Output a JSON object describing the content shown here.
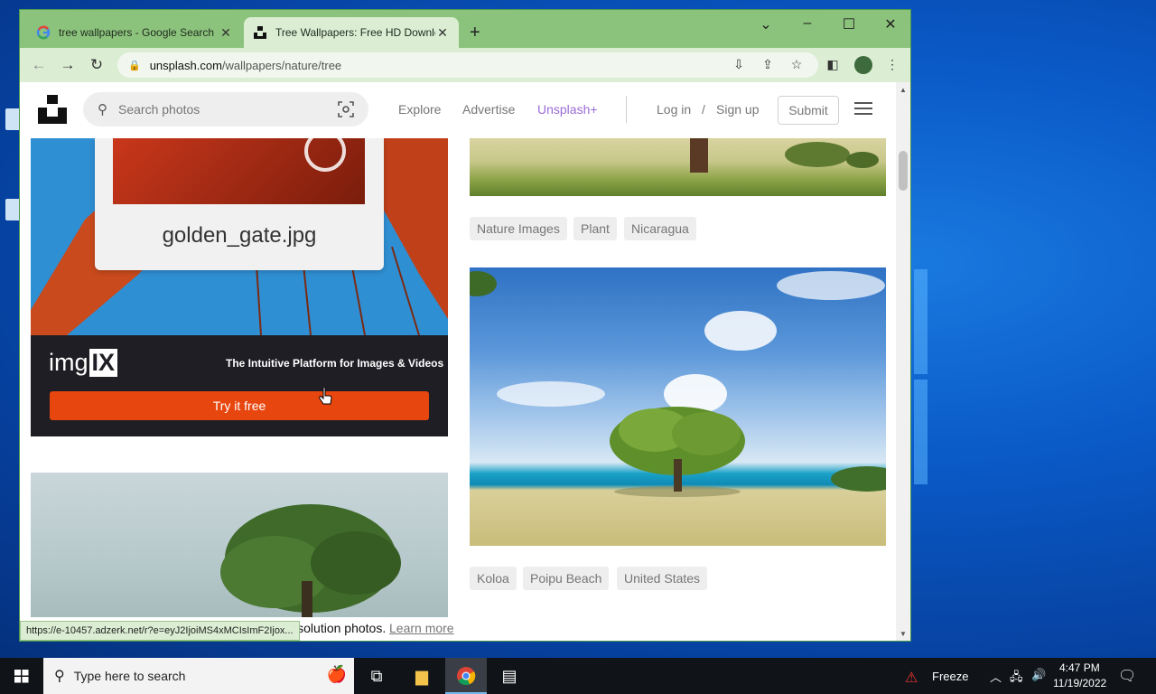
{
  "browser": {
    "tabs": [
      {
        "title": "tree wallpapers - Google Search",
        "active": false,
        "favicon": "google-g-icon"
      },
      {
        "title": "Tree Wallpapers: Free HD Download",
        "active": true,
        "favicon": "unsplash-icon"
      }
    ],
    "url_host": "unsplash.com",
    "url_path": "/wallpapers/nature/tree"
  },
  "site": {
    "search_placeholder": "Search photos",
    "nav": {
      "explore": "Explore",
      "advertise": "Advertise",
      "unsplash_plus": "Unsplash+",
      "login": "Log in",
      "separator": "/",
      "signup": "Sign up",
      "submit": "Submit"
    },
    "ad": {
      "file_name": "golden_gate.jpg",
      "logo_text": "img",
      "logo_box": "IX",
      "tagline": "The Intuitive Platform for Images & Videos",
      "cta": "Try it free"
    },
    "tags_top": [
      "Nature Images",
      "Plant",
      "Nicaragua"
    ],
    "tags_bottom": [
      "Koloa",
      "Poipu Beach",
      "United States"
    ],
    "footer_text": "Download free (do whatever you want) high-resolution photos.",
    "footer_link": "Learn more"
  },
  "status_url": "https://e-10457.adzerk.net/r?e=eyJ2IjoiMS4xMCIsImF2Ijox...",
  "taskbar": {
    "search_placeholder": "Type here to search",
    "freeze_label": "Freeze",
    "time": "4:47 PM",
    "date": "11/19/2022"
  },
  "colors": {
    "tabstrip": "#8cc37c",
    "toolbar": "#dbeed3",
    "cta": "#e8460f",
    "unsplash_plus": "#9b6bd6"
  }
}
